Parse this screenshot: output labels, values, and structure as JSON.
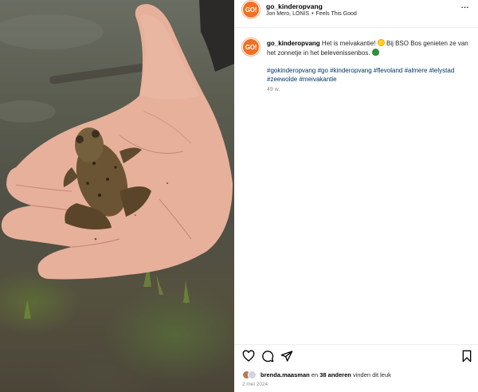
{
  "post": {
    "account": "go_kinderopvang",
    "avatar_text": "GO!",
    "brand_color": "#f36f21",
    "location": "Jon Mero, LÖNIS",
    "separator": "•",
    "audio": "Feels This Good",
    "more_icon": "more-horizontal-icon",
    "caption": {
      "username": "go_kinderopvang",
      "text_part1": "Het is meivakantie!",
      "text_part2": "Bij BSO Bos genieten ze van het zonnetje in het belevenissenbos.",
      "hashtags": "#gokinderopvang #go #kinderopvang #flevoland #almere #lelystad #zeewolde #meivakantie",
      "age": "49 w."
    },
    "actions": {
      "like_icon": "heart-icon",
      "comment_icon": "comment-icon",
      "share_icon": "send-icon",
      "save_icon": "bookmark-icon"
    },
    "likes": {
      "user": "brenda.maasman",
      "connector": "en",
      "others": "38 anderen",
      "suffix": "vinden dit leuk"
    },
    "date": "2 mei 2024"
  }
}
